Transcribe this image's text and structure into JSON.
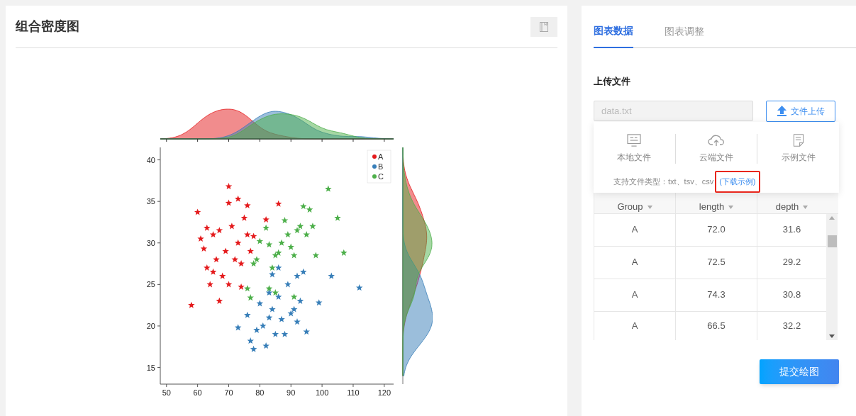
{
  "chart_panel": {
    "title": "组合密度图",
    "chart_data": {
      "type": "scatter",
      "legend": "upper right",
      "xlim": [
        48,
        123
      ],
      "ylim": [
        13,
        41.5
      ],
      "xticks": [
        50,
        60,
        70,
        80,
        90,
        100,
        110,
        120
      ],
      "yticks": [
        15,
        20,
        25,
        30,
        35,
        40
      ],
      "series": [
        {
          "name": "A",
          "color": "#e41a1c",
          "x": [
            58,
            60,
            61,
            62,
            63,
            63,
            64,
            65,
            66,
            67,
            67,
            68,
            69,
            70,
            70,
            71,
            72,
            73,
            73,
            74,
            75,
            76,
            76,
            77,
            78,
            82,
            86,
            74,
            70,
            65
          ],
          "values": [
            22.5,
            33.7,
            30.5,
            29.3,
            31.8,
            27,
            25,
            31,
            28,
            23,
            31.5,
            26,
            29,
            36.8,
            34.8,
            32,
            28,
            35.3,
            30,
            27.5,
            33,
            34.5,
            31,
            29,
            30.8,
            32.8,
            34.7,
            24.7,
            25,
            26.5
          ]
        },
        {
          "name": "B",
          "color": "#377eb8",
          "x": [
            73,
            76,
            77,
            78,
            79,
            80,
            81,
            82,
            83,
            84,
            84,
            85,
            86,
            87,
            88,
            89,
            90,
            91,
            92,
            93,
            94,
            95,
            99,
            103,
            112,
            86,
            83,
            92
          ],
          "values": [
            19.8,
            21.3,
            18.2,
            17.2,
            19.5,
            22.7,
            20,
            17.6,
            21,
            22,
            26.2,
            19,
            23.5,
            20.8,
            19,
            25,
            21.5,
            22,
            26,
            23,
            26.5,
            19.3,
            22.8,
            26,
            24.6,
            27,
            24,
            20.5
          ]
        },
        {
          "name": "C",
          "color": "#4daf4a",
          "x": [
            76,
            77,
            78,
            79,
            80,
            82,
            83,
            84,
            85,
            86,
            87,
            88,
            89,
            90,
            91,
            92,
            93,
            94,
            95,
            96,
            97,
            98,
            102,
            105,
            107,
            91,
            85,
            83
          ],
          "values": [
            24.5,
            23.4,
            27.5,
            28,
            30.2,
            31.8,
            29.8,
            27,
            28.5,
            28.8,
            30,
            32.7,
            31,
            29.5,
            28.5,
            31.5,
            32,
            34.4,
            31,
            34,
            32,
            28.5,
            36.5,
            33,
            28.8,
            23.5,
            24,
            24.5
          ]
        }
      ]
    }
  },
  "tabs": [
    {
      "label": "图表数据",
      "selected": true
    },
    {
      "label": "图表调整",
      "selected": false
    }
  ],
  "upload": {
    "label": "上传文件",
    "file_field": {
      "value": "data.txt"
    },
    "upload_button": "文件上传",
    "menu": {
      "options": [
        {
          "kind": "local",
          "label": "本地文件"
        },
        {
          "kind": "cloud",
          "label": "云端文件"
        },
        {
          "kind": "sample",
          "label": "示例文件"
        }
      ],
      "hint": "支持文件类型：txt、tsv、csv",
      "link": "(下载示例)",
      "link_highlighted": true
    }
  },
  "table": {
    "columns": [
      "Group",
      "length",
      "depth"
    ],
    "rows": [
      [
        "A",
        "72.0",
        "31.6"
      ],
      [
        "A",
        "72.5",
        "29.2"
      ],
      [
        "A",
        "74.3",
        "30.8"
      ],
      [
        "A",
        "66.5",
        "32.2"
      ]
    ]
  },
  "submit_button": "提交绘图"
}
